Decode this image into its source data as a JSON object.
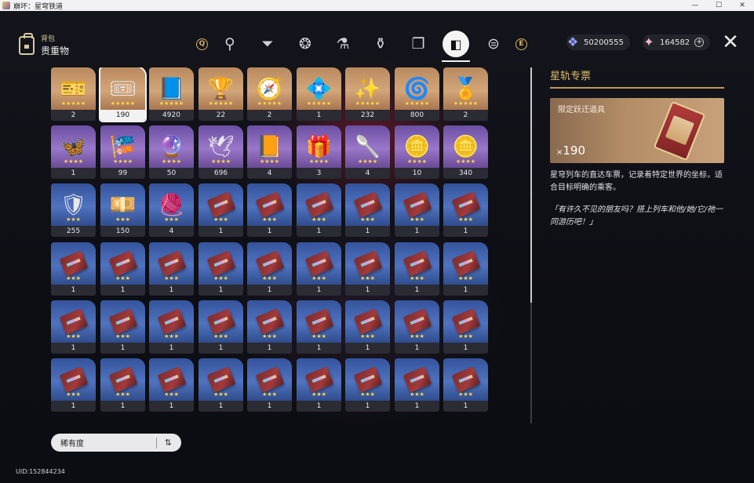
{
  "window": {
    "title": "崩坏：星穹铁道",
    "min": "—",
    "max": "☐",
    "close": "✕"
  },
  "header": {
    "section_small": "背包",
    "section_big": "贵重物"
  },
  "tabs": {
    "key_left": "Q",
    "key_right": "E",
    "items": [
      {
        "name": "light-cone-icon",
        "glyph": "⚲"
      },
      {
        "name": "upgrade-materials-icon",
        "glyph": "⏷"
      },
      {
        "name": "relics-icon",
        "glyph": "❂"
      },
      {
        "name": "other-materials-icon",
        "glyph": "⚗"
      },
      {
        "name": "consumables-icon",
        "glyph": "⚱"
      },
      {
        "name": "missions-icon",
        "glyph": "❐"
      },
      {
        "name": "valuables-icon",
        "glyph": "◧"
      },
      {
        "name": "food-icon",
        "glyph": "⊜"
      }
    ],
    "active_index": 6
  },
  "currencies": [
    {
      "name": "credits",
      "icon": "❖",
      "value": "50200555"
    },
    {
      "name": "stellar-jade",
      "icon": "✦",
      "value": "164582",
      "plus": "+"
    }
  ],
  "close_label": "✕",
  "items": [
    {
      "rarity": 5,
      "glyph": "🎫",
      "count": "2"
    },
    {
      "rarity": 5,
      "glyph": "🎟",
      "count": "190",
      "selected": true
    },
    {
      "rarity": 5,
      "glyph": "📘",
      "count": "4920"
    },
    {
      "rarity": 5,
      "glyph": "🏆",
      "count": "22"
    },
    {
      "rarity": 5,
      "glyph": "🧭",
      "count": "2"
    },
    {
      "rarity": 5,
      "glyph": "💠",
      "count": "1"
    },
    {
      "rarity": 5,
      "glyph": "✨",
      "count": "232"
    },
    {
      "rarity": 5,
      "glyph": "🌀",
      "count": "800"
    },
    {
      "rarity": 5,
      "glyph": "🏅",
      "count": "2"
    },
    {
      "rarity": 4,
      "glyph": "🦋",
      "count": "1"
    },
    {
      "rarity": 4,
      "glyph": "🎏",
      "count": "99"
    },
    {
      "rarity": 4,
      "glyph": "🔮",
      "count": "50"
    },
    {
      "rarity": 4,
      "glyph": "🕊",
      "count": "696"
    },
    {
      "rarity": 4,
      "glyph": "📙",
      "count": "4"
    },
    {
      "rarity": 4,
      "glyph": "🎁",
      "count": "3"
    },
    {
      "rarity": 4,
      "glyph": "🥄",
      "count": "4"
    },
    {
      "rarity": 4,
      "glyph": "🪙",
      "count": "10"
    },
    {
      "rarity": 4,
      "glyph": "🪙",
      "count": "340"
    },
    {
      "rarity": 3,
      "glyph": "🛡",
      "count": "255"
    },
    {
      "rarity": 3,
      "glyph": "💴",
      "count": "150"
    },
    {
      "rarity": 3,
      "glyph": "🧶",
      "count": "4"
    },
    {
      "rarity": 3,
      "glyph": "ticket",
      "count": "1"
    },
    {
      "rarity": 3,
      "glyph": "ticket",
      "count": "1"
    },
    {
      "rarity": 3,
      "glyph": "ticket",
      "count": "1"
    },
    {
      "rarity": 3,
      "glyph": "ticket",
      "count": "1"
    },
    {
      "rarity": 3,
      "glyph": "ticket",
      "count": "1"
    },
    {
      "rarity": 3,
      "glyph": "ticket",
      "count": "1"
    },
    {
      "rarity": 3,
      "glyph": "ticket",
      "count": "1"
    },
    {
      "rarity": 3,
      "glyph": "ticket",
      "count": "1"
    },
    {
      "rarity": 3,
      "glyph": "ticket",
      "count": "1"
    },
    {
      "rarity": 3,
      "glyph": "ticket",
      "count": "1"
    },
    {
      "rarity": 3,
      "glyph": "ticket",
      "count": "1"
    },
    {
      "rarity": 3,
      "glyph": "ticket",
      "count": "1"
    },
    {
      "rarity": 3,
      "glyph": "ticket",
      "count": "1"
    },
    {
      "rarity": 3,
      "glyph": "ticket",
      "count": "1"
    },
    {
      "rarity": 3,
      "glyph": "ticket",
      "count": "1"
    },
    {
      "rarity": 3,
      "glyph": "ticket",
      "count": "1"
    },
    {
      "rarity": 3,
      "glyph": "ticket",
      "count": "1"
    },
    {
      "rarity": 3,
      "glyph": "ticket",
      "count": "1"
    },
    {
      "rarity": 3,
      "glyph": "ticket",
      "count": "1"
    },
    {
      "rarity": 3,
      "glyph": "ticket",
      "count": "1"
    },
    {
      "rarity": 3,
      "glyph": "ticket",
      "count": "1"
    },
    {
      "rarity": 3,
      "glyph": "ticket",
      "count": "1"
    },
    {
      "rarity": 3,
      "glyph": "ticket",
      "count": "1"
    },
    {
      "rarity": 3,
      "glyph": "ticket",
      "count": "1"
    },
    {
      "rarity": 3,
      "glyph": "ticket",
      "count": "1"
    },
    {
      "rarity": 3,
      "glyph": "ticket",
      "count": "1"
    },
    {
      "rarity": 3,
      "glyph": "ticket",
      "count": "1"
    },
    {
      "rarity": 3,
      "glyph": "ticket",
      "count": "1"
    },
    {
      "rarity": 3,
      "glyph": "ticket",
      "count": "1"
    },
    {
      "rarity": 3,
      "glyph": "ticket",
      "count": "1"
    },
    {
      "rarity": 3,
      "glyph": "ticket",
      "count": "1"
    },
    {
      "rarity": 3,
      "glyph": "ticket",
      "count": "1"
    },
    {
      "rarity": 3,
      "glyph": "ticket",
      "count": "1"
    }
  ],
  "detail": {
    "title": "星轨专票",
    "category": "限定跃迁道具",
    "qty_prefix": "×",
    "qty": "190",
    "description": "星穹列车的直达车票，记录着特定世界的坐标，适合目标明确的乘客。",
    "quote": "「有许久不见的朋友吗？搭上列车和他/她/它/祂一同游历吧！」"
  },
  "sort": {
    "label": "稀有度",
    "icon": "⇅"
  },
  "uid": "UID:152844234"
}
